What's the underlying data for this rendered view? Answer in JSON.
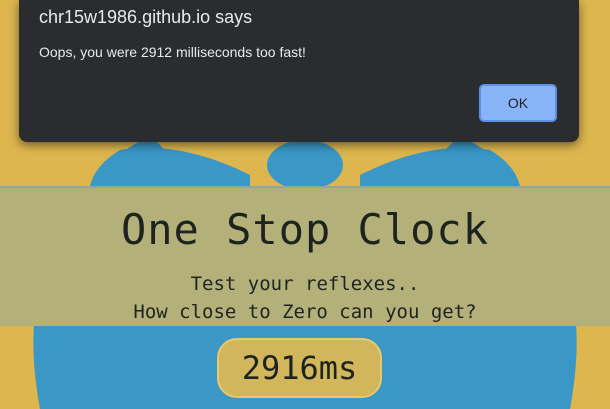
{
  "app": {
    "title": "One Stop Clock",
    "subtitle_line1": "Test your reflexes..",
    "subtitle_line2": "How close to Zero can you get?",
    "timer_value": "2916ms"
  },
  "dialog": {
    "title": "chr15w1986.github.io says",
    "message": "Oops, you were 2912 milliseconds too fast!",
    "ok_label": "OK"
  },
  "colors": {
    "background": "#ddb64e",
    "clock_blue": "#3b97c6",
    "band": "#b4b07a",
    "dialog_bg": "#2a2c30",
    "ok_button": "#8ab4f8"
  }
}
